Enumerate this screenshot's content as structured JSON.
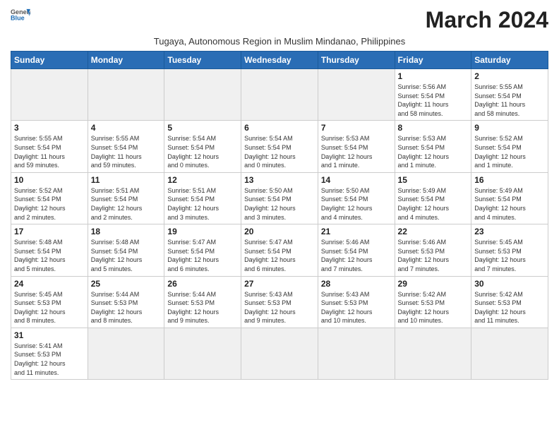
{
  "header": {
    "logo_line1": "General",
    "logo_line2": "Blue",
    "month_title": "March 2024",
    "subtitle": "Tugaya, Autonomous Region in Muslim Mindanao, Philippines"
  },
  "weekdays": [
    "Sunday",
    "Monday",
    "Tuesday",
    "Wednesday",
    "Thursday",
    "Friday",
    "Saturday"
  ],
  "weeks": [
    [
      {
        "day": "",
        "info": ""
      },
      {
        "day": "",
        "info": ""
      },
      {
        "day": "",
        "info": ""
      },
      {
        "day": "",
        "info": ""
      },
      {
        "day": "",
        "info": ""
      },
      {
        "day": "1",
        "info": "Sunrise: 5:56 AM\nSunset: 5:54 PM\nDaylight: 11 hours\nand 58 minutes."
      },
      {
        "day": "2",
        "info": "Sunrise: 5:55 AM\nSunset: 5:54 PM\nDaylight: 11 hours\nand 58 minutes."
      }
    ],
    [
      {
        "day": "3",
        "info": "Sunrise: 5:55 AM\nSunset: 5:54 PM\nDaylight: 11 hours\nand 59 minutes."
      },
      {
        "day": "4",
        "info": "Sunrise: 5:55 AM\nSunset: 5:54 PM\nDaylight: 11 hours\nand 59 minutes."
      },
      {
        "day": "5",
        "info": "Sunrise: 5:54 AM\nSunset: 5:54 PM\nDaylight: 12 hours\nand 0 minutes."
      },
      {
        "day": "6",
        "info": "Sunrise: 5:54 AM\nSunset: 5:54 PM\nDaylight: 12 hours\nand 0 minutes."
      },
      {
        "day": "7",
        "info": "Sunrise: 5:53 AM\nSunset: 5:54 PM\nDaylight: 12 hours\nand 1 minute."
      },
      {
        "day": "8",
        "info": "Sunrise: 5:53 AM\nSunset: 5:54 PM\nDaylight: 12 hours\nand 1 minute."
      },
      {
        "day": "9",
        "info": "Sunrise: 5:52 AM\nSunset: 5:54 PM\nDaylight: 12 hours\nand 1 minute."
      }
    ],
    [
      {
        "day": "10",
        "info": "Sunrise: 5:52 AM\nSunset: 5:54 PM\nDaylight: 12 hours\nand 2 minutes."
      },
      {
        "day": "11",
        "info": "Sunrise: 5:51 AM\nSunset: 5:54 PM\nDaylight: 12 hours\nand 2 minutes."
      },
      {
        "day": "12",
        "info": "Sunrise: 5:51 AM\nSunset: 5:54 PM\nDaylight: 12 hours\nand 3 minutes."
      },
      {
        "day": "13",
        "info": "Sunrise: 5:50 AM\nSunset: 5:54 PM\nDaylight: 12 hours\nand 3 minutes."
      },
      {
        "day": "14",
        "info": "Sunrise: 5:50 AM\nSunset: 5:54 PM\nDaylight: 12 hours\nand 4 minutes."
      },
      {
        "day": "15",
        "info": "Sunrise: 5:49 AM\nSunset: 5:54 PM\nDaylight: 12 hours\nand 4 minutes."
      },
      {
        "day": "16",
        "info": "Sunrise: 5:49 AM\nSunset: 5:54 PM\nDaylight: 12 hours\nand 4 minutes."
      }
    ],
    [
      {
        "day": "17",
        "info": "Sunrise: 5:48 AM\nSunset: 5:54 PM\nDaylight: 12 hours\nand 5 minutes."
      },
      {
        "day": "18",
        "info": "Sunrise: 5:48 AM\nSunset: 5:54 PM\nDaylight: 12 hours\nand 5 minutes."
      },
      {
        "day": "19",
        "info": "Sunrise: 5:47 AM\nSunset: 5:54 PM\nDaylight: 12 hours\nand 6 minutes."
      },
      {
        "day": "20",
        "info": "Sunrise: 5:47 AM\nSunset: 5:54 PM\nDaylight: 12 hours\nand 6 minutes."
      },
      {
        "day": "21",
        "info": "Sunrise: 5:46 AM\nSunset: 5:54 PM\nDaylight: 12 hours\nand 7 minutes."
      },
      {
        "day": "22",
        "info": "Sunrise: 5:46 AM\nSunset: 5:53 PM\nDaylight: 12 hours\nand 7 minutes."
      },
      {
        "day": "23",
        "info": "Sunrise: 5:45 AM\nSunset: 5:53 PM\nDaylight: 12 hours\nand 7 minutes."
      }
    ],
    [
      {
        "day": "24",
        "info": "Sunrise: 5:45 AM\nSunset: 5:53 PM\nDaylight: 12 hours\nand 8 minutes."
      },
      {
        "day": "25",
        "info": "Sunrise: 5:44 AM\nSunset: 5:53 PM\nDaylight: 12 hours\nand 8 minutes."
      },
      {
        "day": "26",
        "info": "Sunrise: 5:44 AM\nSunset: 5:53 PM\nDaylight: 12 hours\nand 9 minutes."
      },
      {
        "day": "27",
        "info": "Sunrise: 5:43 AM\nSunset: 5:53 PM\nDaylight: 12 hours\nand 9 minutes."
      },
      {
        "day": "28",
        "info": "Sunrise: 5:43 AM\nSunset: 5:53 PM\nDaylight: 12 hours\nand 10 minutes."
      },
      {
        "day": "29",
        "info": "Sunrise: 5:42 AM\nSunset: 5:53 PM\nDaylight: 12 hours\nand 10 minutes."
      },
      {
        "day": "30",
        "info": "Sunrise: 5:42 AM\nSunset: 5:53 PM\nDaylight: 12 hours\nand 11 minutes."
      }
    ],
    [
      {
        "day": "31",
        "info": "Sunrise: 5:41 AM\nSunset: 5:53 PM\nDaylight: 12 hours\nand 11 minutes."
      },
      {
        "day": "",
        "info": ""
      },
      {
        "day": "",
        "info": ""
      },
      {
        "day": "",
        "info": ""
      },
      {
        "day": "",
        "info": ""
      },
      {
        "day": "",
        "info": ""
      },
      {
        "day": "",
        "info": ""
      }
    ]
  ]
}
